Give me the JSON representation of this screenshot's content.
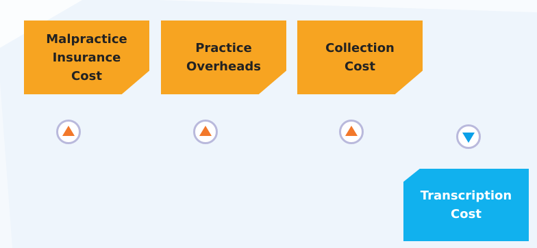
{
  "colors": {
    "background": "#eef5fc",
    "increase_card": "#f7a421",
    "decrease_card": "#11b1ee",
    "increase_arrow": "#f2782a",
    "decrease_arrow": "#0aa0e8",
    "indicator_ring": "#b9b9dc"
  },
  "items": [
    {
      "label": "Malpractice\nInsurance\nCost",
      "direction": "up",
      "icon": "up-arrow-icon"
    },
    {
      "label": "Practice\nOverheads",
      "direction": "up",
      "icon": "up-arrow-icon"
    },
    {
      "label": "Collection\nCost",
      "direction": "up",
      "icon": "up-arrow-icon"
    },
    {
      "label": "Transcription\nCost",
      "direction": "down",
      "icon": "down-arrow-icon"
    }
  ]
}
